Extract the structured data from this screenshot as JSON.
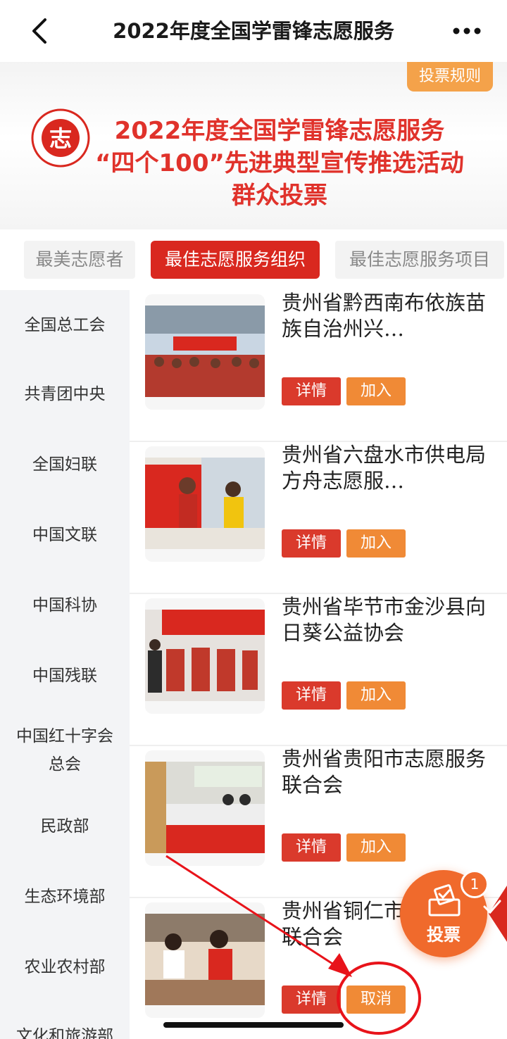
{
  "header": {
    "title": "2022年度全国学雷锋志愿服务",
    "back_icon": "chevron-left-icon",
    "more_icon": "more-dots-icon"
  },
  "banner": {
    "rules_button": "投票规则",
    "line1": "2022年度全国学雷锋志愿服务",
    "line2": "“四个100”先进典型宣传推选活动",
    "line3": "群众投票",
    "logo_char": "志",
    "colors": {
      "headline": "#e0322b",
      "rules_bg": "#f4a24a"
    }
  },
  "tabs": [
    {
      "label": "最美志愿者",
      "active": false
    },
    {
      "label": "最佳志愿服务组织",
      "active": true
    },
    {
      "label": "最佳志愿服务项目",
      "active": false
    }
  ],
  "sidebar": {
    "items": [
      "全国总工会",
      "共青团中央",
      "全国妇联",
      "中国文联",
      "中国科协",
      "中国残联",
      "中国红十字会总会",
      "民政部",
      "生态环境部",
      "农业农村部",
      "文化和旅游部"
    ]
  },
  "list": {
    "items": [
      {
        "name": "贵州省黔西南布依族苗族自治州兴…",
        "detail": "详情",
        "action": "加入",
        "selected": false
      },
      {
        "name": "贵州省六盘水市供电局方舟志愿服…",
        "detail": "详情",
        "action": "加入",
        "selected": false
      },
      {
        "name": "贵州省毕节市金沙县向日葵公益协会",
        "detail": "详情",
        "action": "加入",
        "selected": false
      },
      {
        "name": "贵州省贵阳市志愿服务联合会",
        "detail": "详情",
        "action": "加入",
        "selected": false
      },
      {
        "name": "贵州省铜仁市县大学生联合会",
        "detail": "详情",
        "action": "取消",
        "selected": true
      }
    ]
  },
  "vote_fab": {
    "label": "投票",
    "badge": "1",
    "icon": "ballot-box-icon",
    "color": "#f06a2c"
  },
  "colors": {
    "primary_red": "#d9281f",
    "join_orange": "#f08a36",
    "detail_red": "#da3a2c",
    "annotation_red": "#e8131a"
  }
}
